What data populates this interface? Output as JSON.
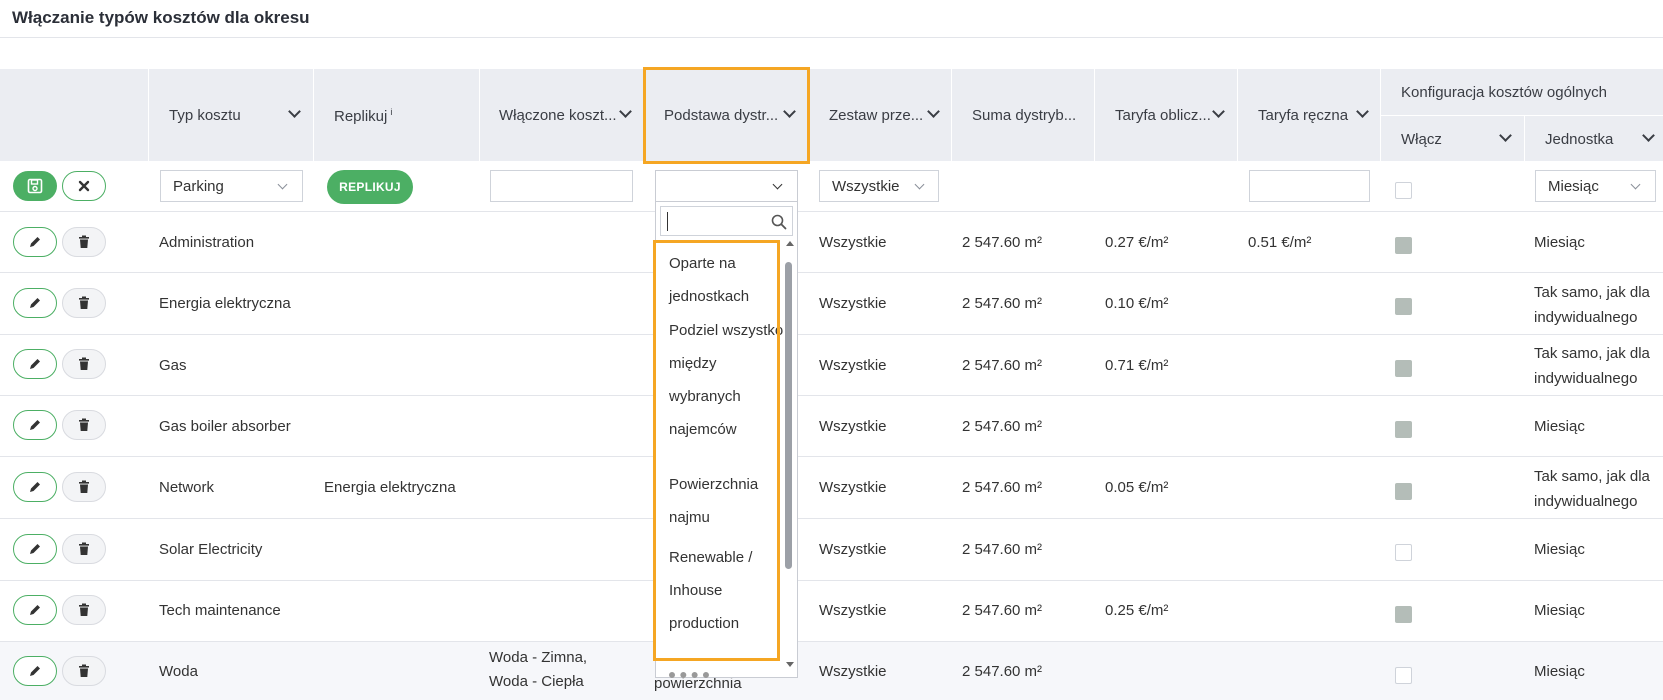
{
  "page": {
    "title": "Włączanie typów kosztów dla okresu"
  },
  "header": {
    "columns": {
      "typ_kosztu": "Typ kosztu",
      "replikuj": "Replikuj",
      "replikuj_sup": "i",
      "wlaczone": "Włączone koszt...",
      "podstawa": "Podstawa dystr...",
      "zestaw": "Zestaw prze...",
      "suma": "Suma dystryb...",
      "taryfa_oblicz": "Taryfa oblicz...",
      "taryfa_reczna": "Taryfa ręczna",
      "konfiguracja": "Konfiguracja kosztów ogólnych",
      "wlacz": "Włącz",
      "jednostka": "Jednostka"
    }
  },
  "edit_row": {
    "typ_kosztu_value": "Parking",
    "replicate_label": "REPLIKUJ",
    "zestaw_value": "Wszystkie",
    "jednostka_value": "Miesiąc",
    "include_checked": false
  },
  "dropdown": {
    "search_value": "",
    "options": [
      "Oparte na jednostkach",
      "Podziel wszystko między wybranych najemców",
      "Powierzchnia najmu",
      "Renewable / Inhouse production"
    ]
  },
  "rows": [
    {
      "typ": "Administration",
      "replikuj": "",
      "wlaczone": "",
      "podstawa": "",
      "zestaw": "Wszystkie",
      "suma": "2 547.60 m²",
      "taryfa_oblicz": "0.27 €/m²",
      "taryfa_reczna": "0.51 €/m²",
      "wlacz": true,
      "jednostka": "Miesiąc"
    },
    {
      "typ": "Energia elektryczna",
      "replikuj": "",
      "wlaczone": "",
      "podstawa": "",
      "zestaw": "Wszystkie",
      "suma": "2 547.60 m²",
      "taryfa_oblicz": "0.10 €/m²",
      "taryfa_reczna": "",
      "wlacz": true,
      "jednostka": "Tak samo, jak dla indywidualnego"
    },
    {
      "typ": "Gas",
      "replikuj": "",
      "wlaczone": "",
      "podstawa": "",
      "zestaw": "Wszystkie",
      "suma": "2 547.60 m²",
      "taryfa_oblicz": "0.71 €/m²",
      "taryfa_reczna": "",
      "wlacz": true,
      "jednostka": "Tak samo, jak dla indywidualnego"
    },
    {
      "typ": "Gas boiler absorber",
      "replikuj": "",
      "wlaczone": "",
      "podstawa": "",
      "zestaw": "Wszystkie",
      "suma": "2 547.60 m²",
      "taryfa_oblicz": "",
      "taryfa_reczna": "",
      "wlacz": true,
      "jednostka": "Miesiąc"
    },
    {
      "typ": "Network",
      "replikuj": "Energia elektryczna",
      "wlaczone": "",
      "podstawa": "",
      "zestaw": "Wszystkie",
      "suma": "2 547.60 m²",
      "taryfa_oblicz": "0.05 €/m²",
      "taryfa_reczna": "",
      "wlacz": true,
      "jednostka": "Tak samo, jak dla indywidualnego"
    },
    {
      "typ": "Solar Electricity",
      "replikuj": "",
      "wlaczone": "",
      "podstawa": "",
      "zestaw": "Wszystkie",
      "suma": "2 547.60 m²",
      "taryfa_oblicz": "",
      "taryfa_reczna": "",
      "wlacz": false,
      "jednostka": "Miesiąc"
    },
    {
      "typ": "Tech maintenance",
      "replikuj": "",
      "wlaczone": "",
      "podstawa": "",
      "zestaw": "Wszystkie",
      "suma": "2 547.60 m²",
      "taryfa_oblicz": "0.25 €/m²",
      "taryfa_reczna": "",
      "wlacz": true,
      "jednostka": "Miesiąc"
    },
    {
      "typ": "Woda",
      "replikuj": "",
      "wlaczone": "Woda - Zimna, Woda - Ciepła",
      "podstawa": "powierzchnia",
      "zestaw": "Wszystkie",
      "suma": "2 547.60 m²",
      "taryfa_oblicz": "",
      "taryfa_reczna": "",
      "wlacz": false,
      "jednostka": "Miesiąc"
    }
  ],
  "colors": {
    "accent_green": "#4caf64",
    "highlight_orange": "#f5a623",
    "header_bg": "#ebedf2"
  },
  "icons": {
    "save": "floppy-disk-icon",
    "cancel": "close-icon",
    "edit": "pencil-icon",
    "delete": "trash-icon",
    "search": "search-icon"
  }
}
